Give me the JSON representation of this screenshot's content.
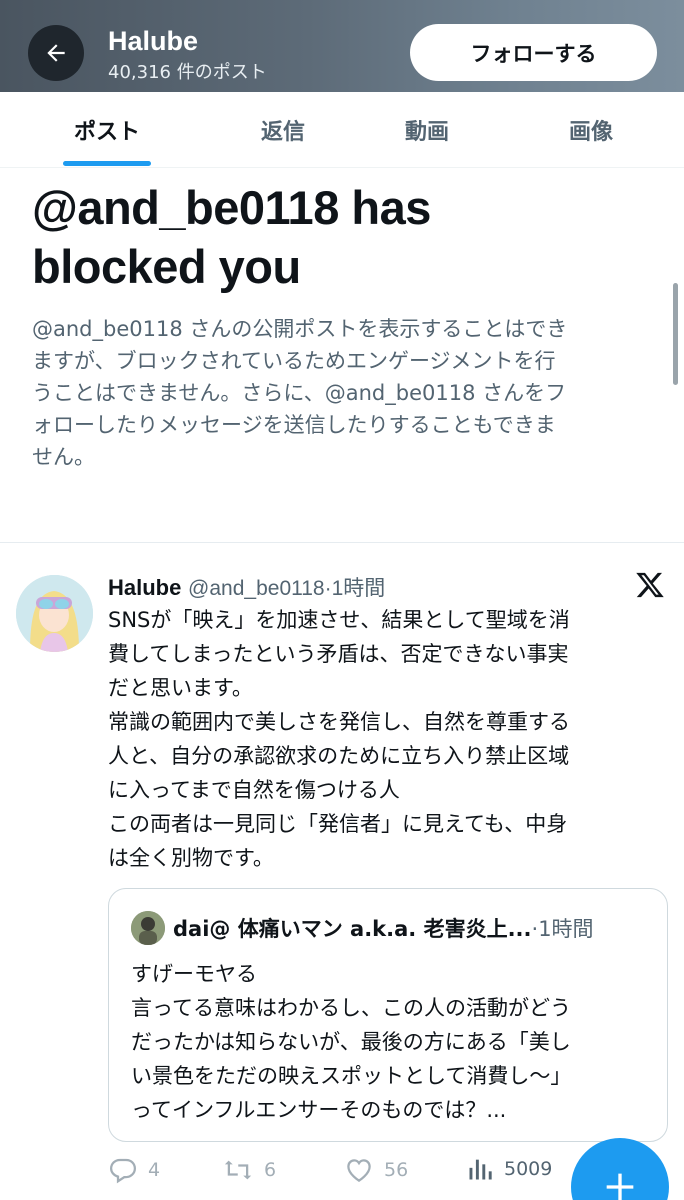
{
  "header": {
    "title": "Halube",
    "subtitle": "40,316 件のポスト",
    "follow_label": "フォローする"
  },
  "tabs": [
    {
      "label": "ポスト",
      "active": true
    },
    {
      "label": "返信",
      "active": false
    },
    {
      "label": "動画",
      "active": false
    },
    {
      "label": "画像",
      "active": false
    }
  ],
  "blocked": {
    "title_line1": "@and_be0118 has",
    "title_line2": "blocked you",
    "desc_lines": [
      "@and_be0118 さんの公開ポストを表示することはでき",
      "ますが、ブロックされているためエンゲージメントを行",
      "うことはできません。さらに、@and_be0118 さんをフ",
      "ォローしたりメッセージを送信したりすることもできま",
      "せん。"
    ]
  },
  "post": {
    "name": "Halube",
    "handle": "@and_be0118",
    "time": "·1時間",
    "lines": [
      "SNSが「映え」を加速させ、結果として聖域を消",
      "費してしまったという矛盾は、否定できない事実",
      "だと思います。",
      "常識の範囲内で美しさを発信し、自然を尊重する",
      "人と、自分の承認欲求のために立ち入り禁止区域",
      "に入ってまで自然を傷つける人",
      "この両者は一見同じ「発信者」に見えても、中身",
      "は全く別物です。"
    ],
    "quote": {
      "name": "dai@ 体痛いマン a.k.a. 老害炎上...",
      "time": "·1時間",
      "lines": [
        "すげーモヤる",
        "言ってる意味はわかるし、この人の活動がどう",
        "だったかは知らないが、最後の方にある「美し",
        "い景色をただの映えスポットとして消費し〜」",
        "ってインフルエンサーそのものでは？..."
      ]
    },
    "stats": {
      "replies": "4",
      "reposts": "6",
      "likes": "56",
      "views": "5009"
    }
  },
  "colors": {
    "accent": "#1d9bf0",
    "text_primary": "#0f1419",
    "text_secondary": "#536471"
  }
}
